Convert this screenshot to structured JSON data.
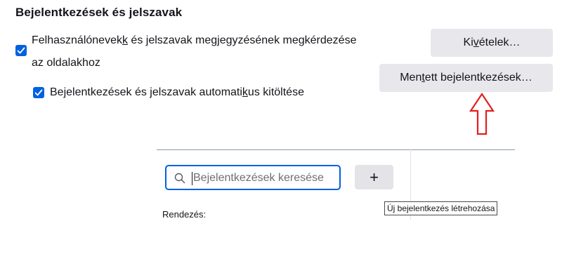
{
  "section": {
    "title": "Bejelentkezések és jelszavak"
  },
  "ask_save": {
    "checked": true,
    "line1_pre": "Felhasználónevek",
    "line1_access": "k",
    "line1_post": " és jelszavak megjegyzésének megkérdezése",
    "line2": "az oldalakhoz"
  },
  "autofill": {
    "checked": true,
    "label_pre": "Bejelentkezések és jelszavak automati",
    "label_access": "k",
    "label_post": "us kitöltése"
  },
  "buttons": {
    "exceptions_pre": "Ki",
    "exceptions_access": "v",
    "exceptions_post": "ételek…",
    "saved_pre": "Men",
    "saved_access": "t",
    "saved_post": "ett bejelentkezések…"
  },
  "annotation": {
    "arrow_color": "#e02020"
  },
  "logins_panel": {
    "search_placeholder": "Bejelentkezések keresése",
    "add_label": "+",
    "tooltip": "Új bejelentkezés létrehozása",
    "sort_label": "Rendezés:"
  },
  "colors": {
    "accent": "#0061e0",
    "button_bg": "#e8e8ec"
  }
}
